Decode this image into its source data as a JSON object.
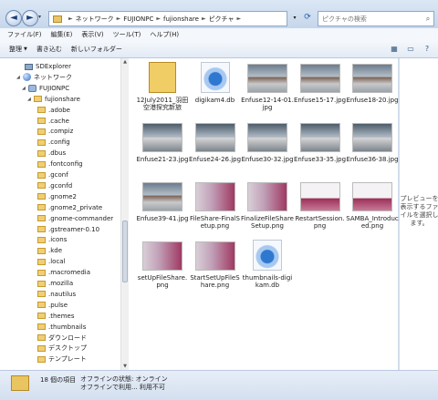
{
  "breadcrumb": [
    "ネットワーク",
    "FUJIONPC",
    "fujionshare",
    "ピクチャ"
  ],
  "search": {
    "placeholder": "ピクチャの検索"
  },
  "menu": [
    "ファイル(F)",
    "編集(E)",
    "表示(V)",
    "ツール(T)",
    "ヘルプ(H)"
  ],
  "toolbar": {
    "organize": "整理",
    "burn": "書き込む",
    "new_folder": "新しいフォルダー"
  },
  "nav": {
    "items": [
      {
        "label": "SDExplorer",
        "icon": "pc"
      },
      {
        "label": "ネットワーク",
        "icon": "network"
      },
      {
        "label": "FUJIONPC",
        "icon": "computer"
      },
      {
        "label": "fujionshare",
        "icon": "folder"
      },
      {
        "label": ".adobe",
        "icon": "folder"
      },
      {
        "label": ".cache",
        "icon": "folder"
      },
      {
        "label": ".compiz",
        "icon": "folder"
      },
      {
        "label": ".config",
        "icon": "folder"
      },
      {
        "label": ".dbus",
        "icon": "folder"
      },
      {
        "label": ".fontconfig",
        "icon": "folder"
      },
      {
        "label": ".gconf",
        "icon": "folder"
      },
      {
        "label": ".gconfd",
        "icon": "folder"
      },
      {
        "label": ".gnome2",
        "icon": "folder"
      },
      {
        "label": ".gnome2_private",
        "icon": "folder"
      },
      {
        "label": ".gnome-commander",
        "icon": "folder"
      },
      {
        "label": ".gstreamer-0.10",
        "icon": "folder"
      },
      {
        "label": ".icons",
        "icon": "folder"
      },
      {
        "label": ".kde",
        "icon": "folder"
      },
      {
        "label": ".local",
        "icon": "folder"
      },
      {
        "label": ".macromedia",
        "icon": "folder"
      },
      {
        "label": ".mozilla",
        "icon": "folder"
      },
      {
        "label": ".nautilus",
        "icon": "folder"
      },
      {
        "label": ".pulse",
        "icon": "folder"
      },
      {
        "label": ".themes",
        "icon": "folder"
      },
      {
        "label": ".thumbnails",
        "icon": "folder"
      },
      {
        "label": "ダウンロード",
        "icon": "folder"
      },
      {
        "label": "デスクトップ",
        "icon": "folder"
      },
      {
        "label": "テンプレート",
        "icon": "folder"
      }
    ]
  },
  "files": [
    {
      "name": "12July2011_羽田空港探究新旅",
      "kind": "folder"
    },
    {
      "name": "digikam4.db",
      "kind": "db"
    },
    {
      "name": "Enfuse12-14-01.jpg",
      "kind": "photo"
    },
    {
      "name": "Enfuse15-17.jpg",
      "kind": "photo"
    },
    {
      "name": "Enfuse18-20.jpg",
      "kind": "photo"
    },
    {
      "name": "Enfuse21-23.jpg",
      "kind": "photo2"
    },
    {
      "name": "Enfuse24-26.jpg",
      "kind": "photo2"
    },
    {
      "name": "Enfuse30-32.jpg",
      "kind": "photo2"
    },
    {
      "name": "Enfuse33-35.jpg",
      "kind": "photo2"
    },
    {
      "name": "Enfuse36-38.jpg",
      "kind": "photo2"
    },
    {
      "name": "Enfuse39-41.jpg",
      "kind": "photo"
    },
    {
      "name": "FileShare-FinalSetup.png",
      "kind": "shot"
    },
    {
      "name": "FinalizeFileShareSetup.png",
      "kind": "shot"
    },
    {
      "name": "RestartSession.png",
      "kind": "shot2"
    },
    {
      "name": "SAMBA_Introduced.png",
      "kind": "shot2"
    },
    {
      "name": "setUpFileShare.png",
      "kind": "shot"
    },
    {
      "name": "StartSetUpFileShare.png",
      "kind": "shot"
    },
    {
      "name": "thumbnails-digikam.db",
      "kind": "db"
    }
  ],
  "preview_text": "プレビューを表示するファイルを選択します。",
  "status": {
    "count": "18 個の項目",
    "offline_status": "オフラインの状態: オンライン",
    "offline_avail": "オフラインで利用...   利用不可"
  }
}
